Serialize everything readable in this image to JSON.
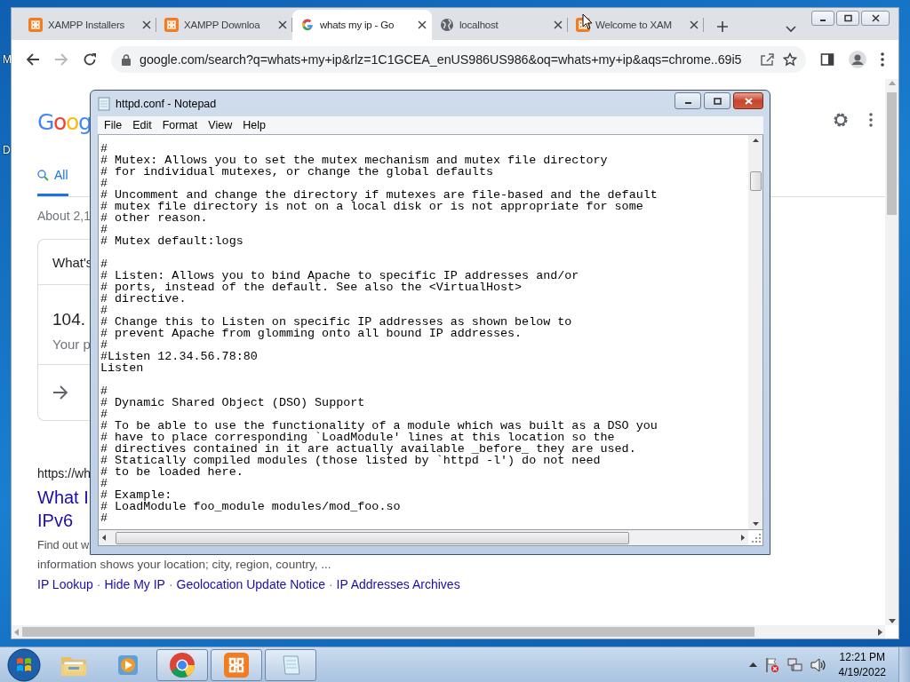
{
  "desktop": {
    "icon_labels": [
      "M",
      "D"
    ]
  },
  "browser": {
    "tabs": [
      {
        "title": "XAMPP Installers",
        "kind": "xampp",
        "selected": false
      },
      {
        "title": "XAMPP Downloa",
        "kind": "xampp",
        "selected": false
      },
      {
        "title": "whats my ip - Go",
        "kind": "google",
        "selected": true
      },
      {
        "title": "localhost",
        "kind": "globe",
        "selected": false
      },
      {
        "title": "Welcome to XAM",
        "kind": "xampp",
        "selected": false
      }
    ],
    "address": "google.com/search?q=whats+my+ip&rlz=1C1GCEA_enUS986US986&oq=whats+my+ip&aqs=chrome..69i5",
    "page": {
      "logo": "Goog",
      "nav_tabs": [
        {
          "label": "All",
          "selected": true
        }
      ],
      "result_stats": "About 2,1",
      "answer_card": {
        "question": "What's",
        "ip": "104.",
        "caption": "Your p"
      },
      "result": {
        "url": "https://wh",
        "title_lines": [
          "What I",
          "IPv6"
        ],
        "snippet": [
          "Find out w",
          "information shows your location; city, region, country, ..."
        ],
        "links": [
          "IP Lookup",
          "Hide My IP",
          "Geolocation Update Notice",
          "IP Addresses Archives"
        ],
        "separator": "·"
      }
    }
  },
  "notepad": {
    "title": "httpd.conf - Notepad",
    "menu": [
      "File",
      "Edit",
      "Format",
      "View",
      "Help"
    ],
    "content": "#\n# Mutex: Allows you to set the mutex mechanism and mutex file directory\n# for individual mutexes, or change the global defaults\n#\n# Uncomment and change the directory if mutexes are file-based and the default\n# mutex file directory is not on a local disk or is not appropriate for some\n# other reason.\n#\n# Mutex default:logs\n\n#\n# Listen: Allows you to bind Apache to specific IP addresses and/or\n# ports, instead of the default. See also the <VirtualHost>\n# directive.\n#\n# Change this to Listen on specific IP addresses as shown below to\n# prevent Apache from glomming onto all bound IP addresses.\n#\n#Listen 12.34.56.78:80\nListen\n\n#\n# Dynamic Shared Object (DSO) Support\n#\n# To be able to use the functionality of a module which was built as a DSO you\n# have to place corresponding `LoadModule' lines at this location so the\n# directives contained in it are actually available _before_ they are used.\n# Statically compiled modules (those listed by `httpd -l') do not need\n# to be loaded here.\n#\n# Example:\n# LoadModule foo_module modules/mod_foo.so\n#"
  },
  "taskbar": {
    "apps": [
      {
        "kind": "explorer",
        "running": false
      },
      {
        "kind": "media",
        "running": false
      },
      {
        "kind": "chrome",
        "running": true
      },
      {
        "kind": "xampp",
        "running": true
      },
      {
        "kind": "notepad",
        "running": true
      }
    ],
    "clock": {
      "time": "12:21 PM",
      "date": "4/19/2022"
    }
  }
}
